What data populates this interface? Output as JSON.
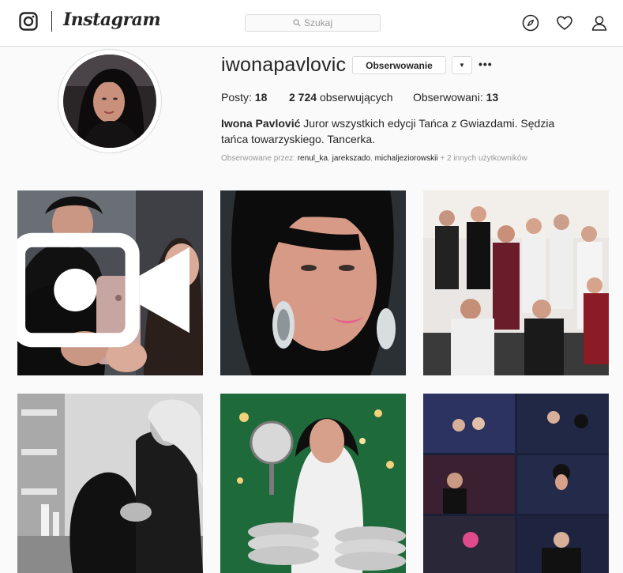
{
  "header": {
    "brand": "Instagram",
    "search_placeholder": "Szukaj",
    "icons": [
      "instagram-logo-icon",
      "search-icon",
      "compass-icon",
      "heart-icon",
      "user-icon"
    ]
  },
  "profile": {
    "username": "iwonapavlovic",
    "follow_label": "Obserwowanie",
    "dropdown_label": "▼",
    "more_label": "•••",
    "stats": {
      "posts_label": "Posty:",
      "posts_value": "18",
      "followers_value": "2 724",
      "followers_label": "obserwujących",
      "following_label": "Obserwowani:",
      "following_value": "13"
    },
    "bio_name": "Iwona Pavlović",
    "bio_text": " Juror wszystkich edycji Tańca z Gwiazdami. Sędzia tańca towarzyskiego. Tancerka.",
    "followed_by": {
      "prefix": "Obserwowane przez:",
      "user1": "renul_ka",
      "user2": "jarekszado",
      "user3": "michaljeziorowskii",
      "suffix": "+ 2 innych użytkowników"
    }
  },
  "posts": [
    {
      "kind": "video",
      "badge_icon": "video-camera-icon"
    },
    {
      "kind": "photo"
    },
    {
      "kind": "photo"
    },
    {
      "kind": "photo"
    },
    {
      "kind": "photo"
    },
    {
      "kind": "photo"
    }
  ],
  "colors": {
    "border": "#dbdbdb",
    "text": "#262626",
    "muted": "#999999",
    "background": "#fafafa"
  }
}
